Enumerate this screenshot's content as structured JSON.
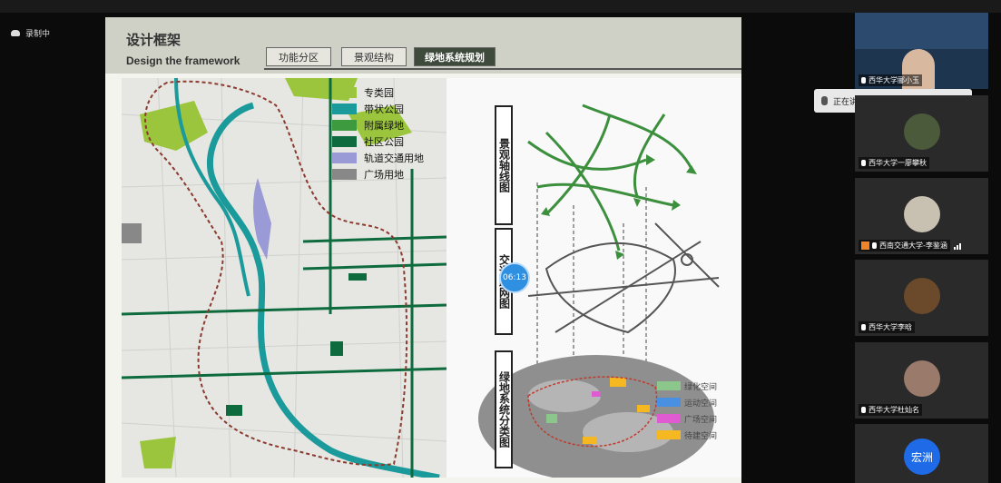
{
  "recording": {
    "label": "录制中"
  },
  "slide": {
    "title_cn": "设计框架",
    "title_en": "Design the framework",
    "tabs": [
      "功能分区",
      "景观结构",
      "绿地系统规划"
    ],
    "active_tab": 2,
    "legend": [
      {
        "label": "专类园",
        "color": "#9bc53d"
      },
      {
        "label": "带状公园",
        "color": "#1a9a9a"
      },
      {
        "label": "附属绿地",
        "color": "#3e9a3e"
      },
      {
        "label": "社区公园",
        "color": "#0e6b3e"
      },
      {
        "label": "轨道交通用地",
        "color": "#9a9ad6"
      },
      {
        "label": "广场用地",
        "color": "#888888"
      }
    ],
    "vertical_labels": [
      "景观轴线图",
      "交通路网图",
      "绿地系统分类图"
    ],
    "sub_legend": [
      {
        "label": "绿化空间",
        "color": "#8bc78b"
      },
      {
        "label": "运动空间",
        "color": "#4a90e2"
      },
      {
        "label": "广场空间",
        "color": "#e05ad1"
      },
      {
        "label": "待建空间",
        "color": "#f5b820"
      }
    ]
  },
  "timer": "06:13",
  "speaker_popup": "正在讲话: 西华大学郦小玉;",
  "participants": [
    {
      "name": "西华大学郦小玉"
    },
    {
      "name": "西华大学一廖攀秋"
    },
    {
      "name": "西南交通大学-李鉴涵"
    },
    {
      "name": "西华大学李晗"
    },
    {
      "name": "西华大学杜灿名"
    },
    {
      "name": "宏洲"
    }
  ]
}
